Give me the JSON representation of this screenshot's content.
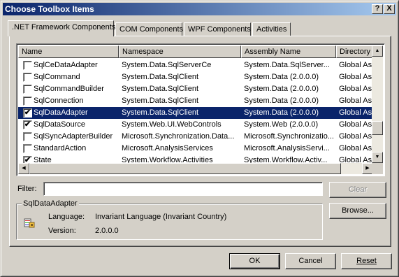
{
  "window": {
    "title": "Choose Toolbox Items",
    "help_glyph": "?",
    "close_glyph": "X"
  },
  "tabs": [
    {
      "label": ".NET Framework Components",
      "active": true
    },
    {
      "label": "COM Components"
    },
    {
      "label": "WPF Components"
    },
    {
      "label": "Activities"
    }
  ],
  "list": {
    "columns": [
      "Name",
      "Namespace",
      "Assembly Name",
      "Directory"
    ],
    "rows": [
      {
        "name": "SqlCeDataAdapter",
        "namespace": "System.Data.SqlServerCe",
        "assembly": "System.Data.SqlServer...",
        "directory": "Global Ass",
        "checked": false,
        "selected": false
      },
      {
        "name": "SqlCommand",
        "namespace": "System.Data.SqlClient",
        "assembly": "System.Data (2.0.0.0)",
        "directory": "Global Ass",
        "checked": false,
        "selected": false
      },
      {
        "name": "SqlCommandBuilder",
        "namespace": "System.Data.SqlClient",
        "assembly": "System.Data (2.0.0.0)",
        "directory": "Global Ass",
        "checked": false,
        "selected": false
      },
      {
        "name": "SqlConnection",
        "namespace": "System.Data.SqlClient",
        "assembly": "System.Data (2.0.0.0)",
        "directory": "Global Ass",
        "checked": false,
        "selected": false
      },
      {
        "name": "SqlDataAdapter",
        "namespace": "System.Data.SqlClient",
        "assembly": "System.Data (2.0.0.0)",
        "directory": "Global Ass",
        "checked": true,
        "selected": true
      },
      {
        "name": "SqlDataSource",
        "namespace": "System.Web.UI.WebControls",
        "assembly": "System.Web (2.0.0.0)",
        "directory": "Global Ass",
        "checked": true,
        "selected": false
      },
      {
        "name": "SqlSyncAdapterBuilder",
        "namespace": "Microsoft.Synchronization.Data...",
        "assembly": "Microsoft.Synchronizatio...",
        "directory": "Global Ass",
        "checked": false,
        "selected": false
      },
      {
        "name": "StandardAction",
        "namespace": "Microsoft.AnalysisServices",
        "assembly": "Microsoft.AnalysisServi...",
        "directory": "Global Ass",
        "checked": false,
        "selected": false
      },
      {
        "name": "State",
        "namespace": "System.Workflow.Activities",
        "assembly": "System.Workflow.Activ...",
        "directory": "Global Ass",
        "checked": true,
        "selected": false
      }
    ],
    "scroll_up": "▲",
    "scroll_down": "▼",
    "scroll_left": "◀",
    "scroll_right": "▶"
  },
  "filter": {
    "label": "Filter:",
    "value": "",
    "clear_label": "Clear"
  },
  "details": {
    "group_title": "SqlDataAdapter",
    "language_label": "Language:",
    "language_value": "Invariant Language (Invariant Country)",
    "version_label": "Version:",
    "version_value": "2.0.0.0",
    "icon": "sqldataadapter-icon"
  },
  "buttons": {
    "browse": "Browse...",
    "ok": "OK",
    "cancel": "Cancel",
    "reset": "Reset"
  },
  "check_glyph": "✔"
}
